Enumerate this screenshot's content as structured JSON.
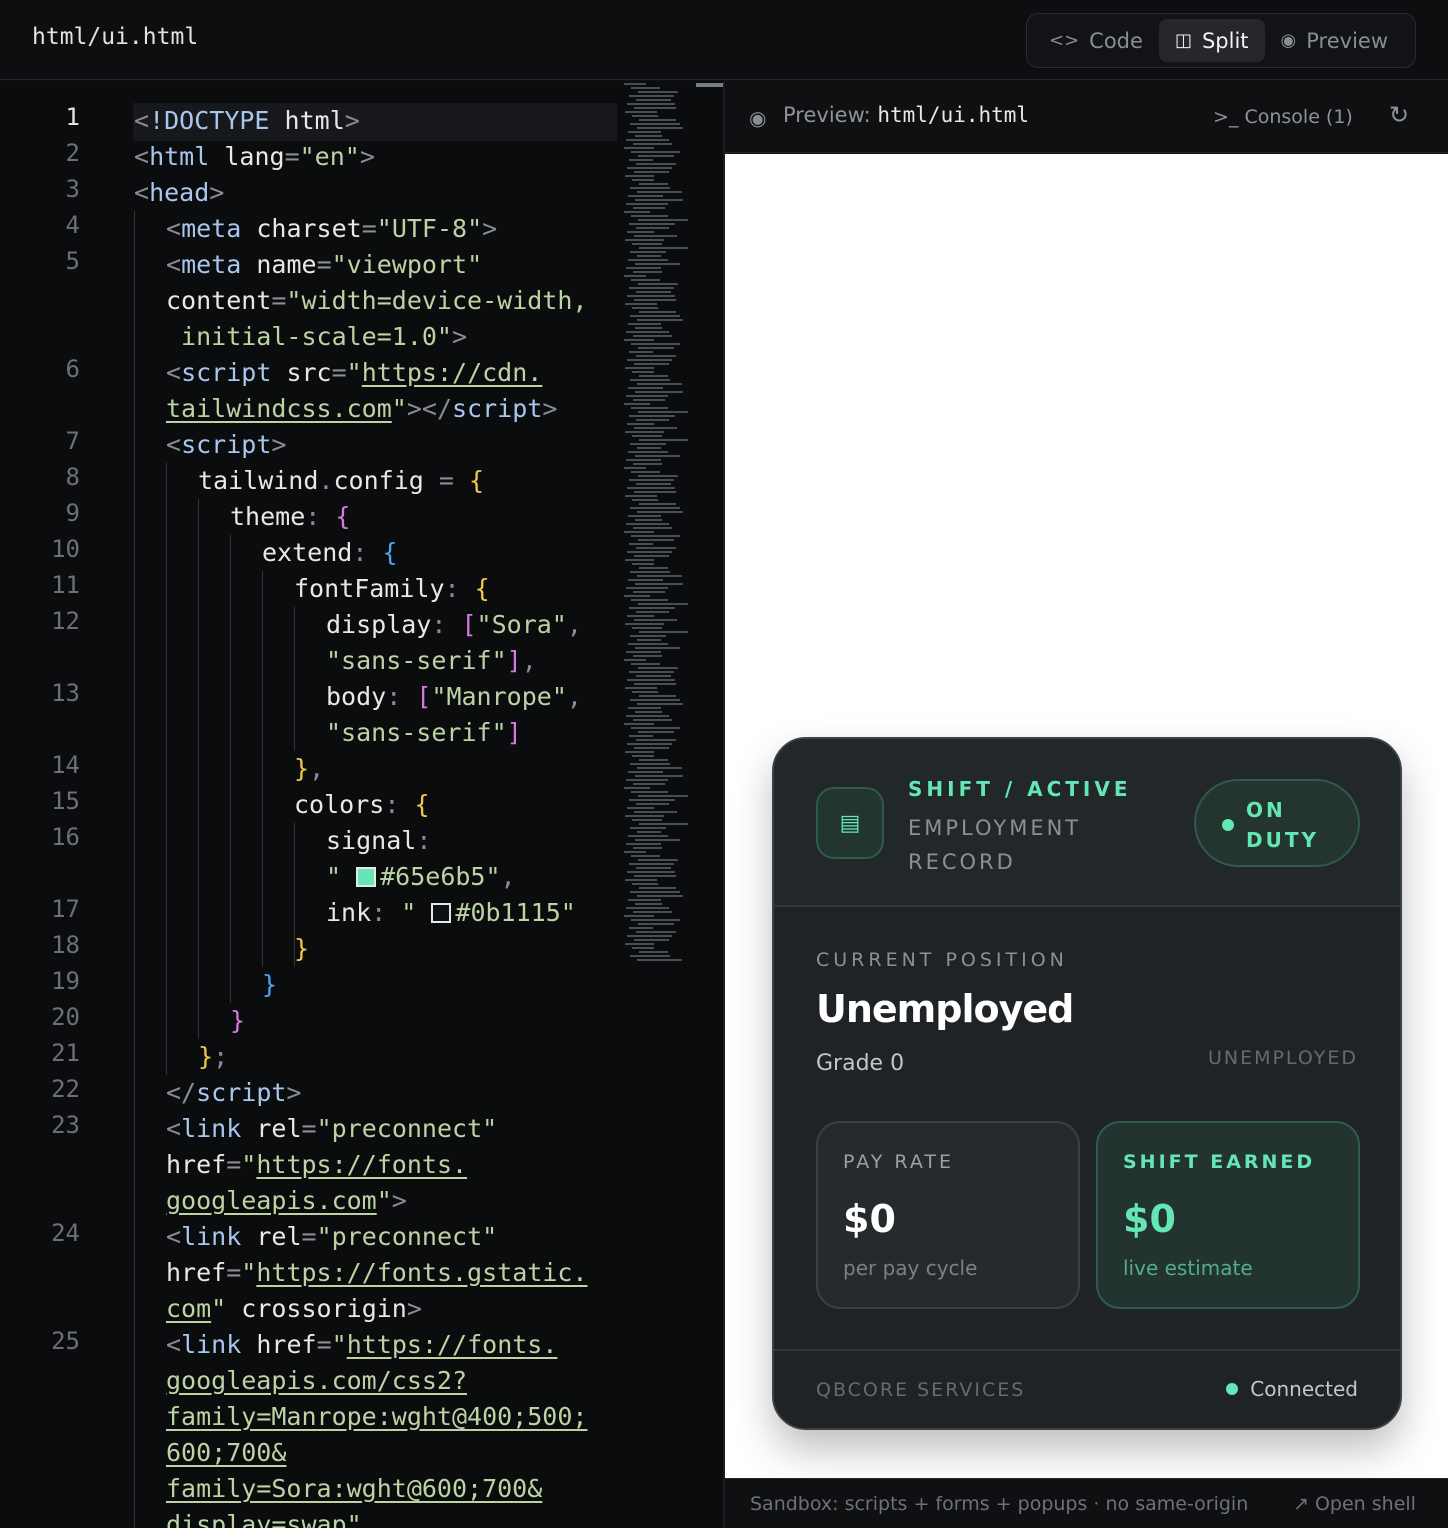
{
  "topbar": {
    "filename": "html/ui.html",
    "modes": [
      {
        "label": "Code",
        "icon": "code-icon"
      },
      {
        "label": "Split",
        "icon": "split-icon"
      },
      {
        "label": "Preview",
        "icon": "eye-icon"
      }
    ],
    "active_mode": "Split"
  },
  "editor": {
    "current_line": 1,
    "line_numbers": [
      "1",
      "2",
      "3",
      "4",
      "5",
      "6",
      "7",
      "8",
      "9",
      "10",
      "11",
      "12",
      "13",
      "14",
      "15",
      "16",
      "17",
      "18",
      "19",
      "20",
      "21",
      "22",
      "23",
      "24",
      "25"
    ]
  },
  "preview": {
    "title_prefix": "Preview:",
    "title_file": "html/ui.html",
    "console_label": "Console (1)",
    "footer_left": "Sandbox: scripts + forms + popups · no same-origin",
    "footer_right": "Open shell"
  },
  "card": {
    "kicker": "SHIFT / ACTIVE",
    "subtitle": "EMPLOYMENT RECORD",
    "duty_status": "ON DUTY",
    "position_label": "CURRENT POSITION",
    "position_title": "Unemployed",
    "grade": "Grade 0",
    "status_tag": "UNEMPLOYED",
    "pay": {
      "label": "PAY RATE",
      "value": "$0",
      "sub": "per pay cycle"
    },
    "earned": {
      "label": "SHIFT EARNED",
      "value": "$0",
      "sub": "live estimate"
    },
    "footer_service": "QBCORE SERVICES",
    "footer_status": "Connected"
  },
  "colors": {
    "signal": "#65e6b5",
    "ink": "#0b1115"
  }
}
